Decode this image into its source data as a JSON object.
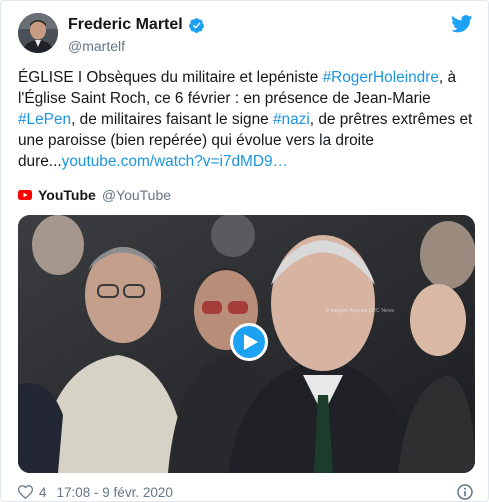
{
  "author": {
    "display_name": "Frederic Martel",
    "handle": "@martelf",
    "verified": true,
    "avatar_icon": "avatar-photo"
  },
  "tweet": {
    "segments": [
      {
        "text": "ÉGLISE I Obsèques du militaire et lepéniste ",
        "link": false
      },
      {
        "text": "#RogerHoleindre",
        "link": true
      },
      {
        "text": ", à l'Église Saint Roch, ce 6 février : en présence de Jean-Marie ",
        "link": false
      },
      {
        "text": "#LePen",
        "link": true
      },
      {
        "text": ", de militaires faisant le signe ",
        "link": false
      },
      {
        "text": "#nazi",
        "link": true
      },
      {
        "text": ", de prêtres extrêmes et une paroisse (bien repérée) qui évolue vers la droite dure...",
        "link": false
      },
      {
        "text": "youtube.com/watch?v=i7dMD9…",
        "link": true
      }
    ]
  },
  "card": {
    "source_name": "YouTube",
    "source_handle": "@YouTube",
    "watermark": "© Images Agence LDC News",
    "play_icon": "play-icon"
  },
  "footer": {
    "likes": "4",
    "timestamp": "17:08 - 9 févr. 2020"
  },
  "colors": {
    "link": "#1b95e0",
    "twitter_blue": "#1da1f2",
    "muted": "#657786",
    "youtube_red": "#ff0000"
  }
}
